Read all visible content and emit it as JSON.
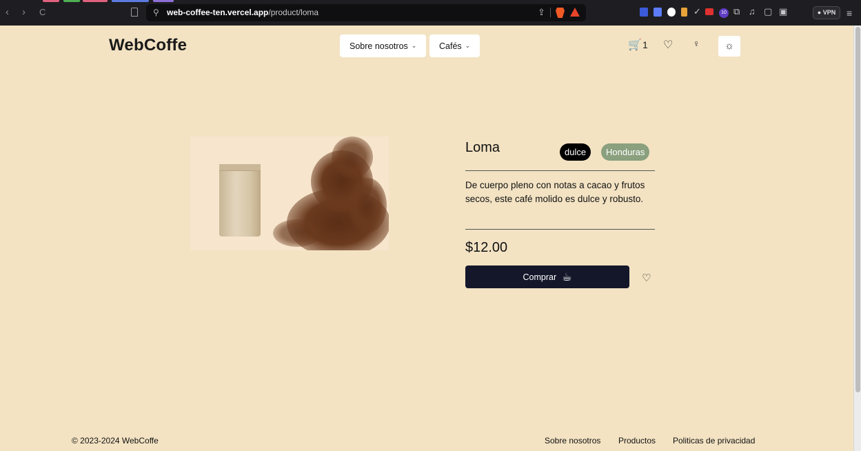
{
  "browser": {
    "url_domain": "web-coffee-ten.vercel.app",
    "url_path": "/product/loma",
    "vpn_label": "VPN",
    "extension_badge": "10",
    "nav_back": "‹",
    "nav_forward": "›",
    "nav_reload": "C"
  },
  "header": {
    "logo": "WebCoffe",
    "nav": [
      {
        "label": "Sobre nosotros"
      },
      {
        "label": "Cafés"
      }
    ],
    "cart_count": "1",
    "icons": [
      "cart-icon",
      "heart-icon",
      "user-icon",
      "sun-icon"
    ]
  },
  "product": {
    "name": "Loma",
    "tags": [
      "dulce",
      "Honduras"
    ],
    "description": "De cuerpo pleno con notas a cacao y frutos secos, este café molido es dulce y robusto.",
    "price": "$12.00",
    "buy_label": "Comprar"
  },
  "footer": {
    "copyright": "© 2023-2024 WebCoffe",
    "links": [
      "Sobre nosotros",
      "Productos",
      "Politicas de privacidad"
    ]
  },
  "colors": {
    "page_bg": "#f3e3c3",
    "button_dark": "#14172a",
    "tag_dark": "#000000",
    "tag_green": "#8aa07e"
  }
}
